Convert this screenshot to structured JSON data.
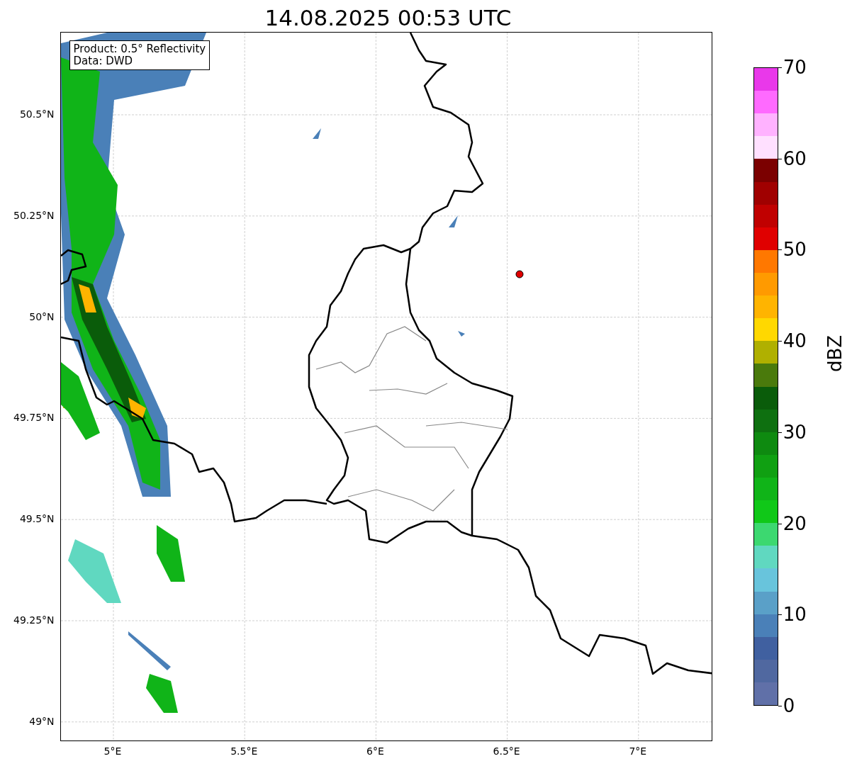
{
  "title": "14.08.2025 00:53 UTC",
  "map": {
    "info_box": [
      "Product: 0.5° Reflectivity",
      "Data: DWD"
    ],
    "y_ticks": [
      "50.5°N",
      "50.25°N",
      "50°N",
      "49.75°N",
      "49.5°N",
      "49.25°N",
      "49°N"
    ],
    "x_ticks": [
      "5°E",
      "5.5°E",
      "6°E",
      "6.5°E",
      "7°E"
    ]
  },
  "colorbar": {
    "label": "dBZ",
    "ticks": [
      "70",
      "60",
      "50",
      "40",
      "30",
      "20",
      "10",
      "0"
    ],
    "bins": [
      {
        "color": "#e938ea"
      },
      {
        "color": "#ff6aff"
      },
      {
        "color": "#ffb2ff"
      },
      {
        "color": "#ffe0ff"
      },
      {
        "color": "#7b0000"
      },
      {
        "color": "#a00000"
      },
      {
        "color": "#c00000"
      },
      {
        "color": "#e00000"
      },
      {
        "color": "#ff7800"
      },
      {
        "color": "#ff9a00"
      },
      {
        "color": "#ffb400"
      },
      {
        "color": "#ffd800"
      },
      {
        "color": "#b0b000"
      },
      {
        "color": "#4a7a0c"
      },
      {
        "color": "#0a5c0a"
      },
      {
        "color": "#0e7010"
      },
      {
        "color": "#0e8a10"
      },
      {
        "color": "#10a012"
      },
      {
        "color": "#10b418"
      },
      {
        "color": "#10c818"
      },
      {
        "color": "#3cd870"
      },
      {
        "color": "#60d8c0"
      },
      {
        "color": "#68c4dc"
      },
      {
        "color": "#5aa0c8"
      },
      {
        "color": "#4a80b8"
      },
      {
        "color": "#4060a0"
      },
      {
        "color": "#5068a0"
      },
      {
        "color": "#6070a8"
      }
    ]
  }
}
